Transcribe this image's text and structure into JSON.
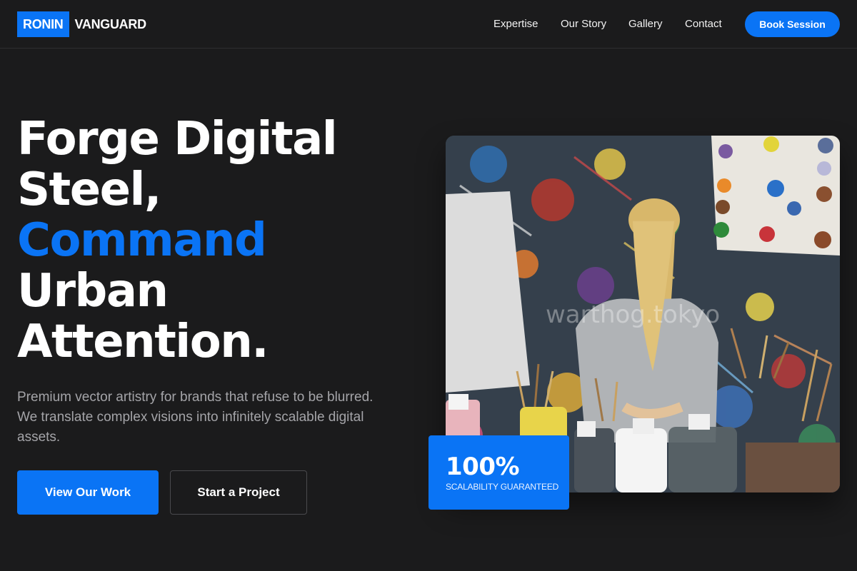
{
  "brand": {
    "logo_box": "RONIN",
    "logo_text": "VANGUARD",
    "accent_color": "#0a74f5"
  },
  "nav": {
    "items": [
      {
        "label": "Expertise"
      },
      {
        "label": "Our Story"
      },
      {
        "label": "Gallery"
      },
      {
        "label": "Contact"
      }
    ],
    "cta_label": "Book Session"
  },
  "hero": {
    "headline_line1": "Forge Digital",
    "headline_line2": "Steel,",
    "headline_accent": "Command",
    "headline_line4": "Urban",
    "headline_line5": "Attention.",
    "subtext": "Premium vector artistry for brands that refuse to be blurred. We translate complex visions into infinitely scalable digital assets.",
    "primary_button": "View Our Work",
    "secondary_button": "Start a Project",
    "image_watermark": "warthog.tokyo",
    "stat_value": "100%",
    "stat_label": "SCALABILITY GUARANTEED"
  }
}
